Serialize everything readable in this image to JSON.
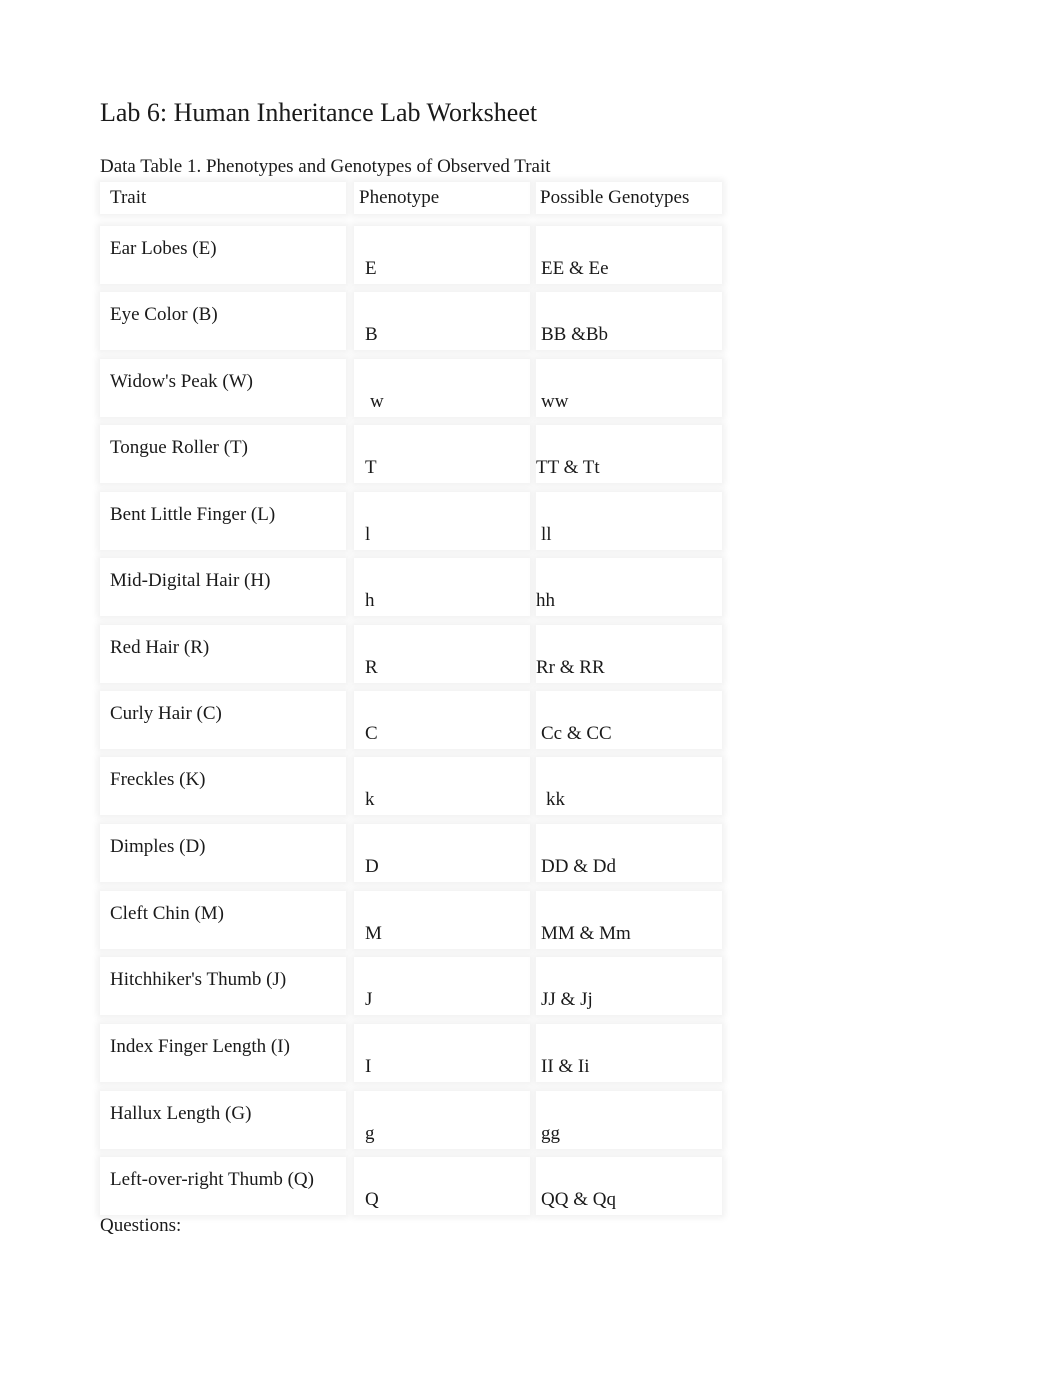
{
  "document": {
    "title": "Lab 6: Human Inheritance Lab Worksheet",
    "table_caption": "Data Table 1. Phenotypes and Genotypes of Observed Trait",
    "table": {
      "headers": [
        "Trait",
        "Phenotype",
        "Possible Genotypes"
      ],
      "rows": [
        {
          "trait": "Ear Lobes (E)",
          "phenotype": "E",
          "genotypes": "EE & Ee"
        },
        {
          "trait": "Eye Color (B)",
          "phenotype": "B",
          "genotypes": "BB &Bb"
        },
        {
          "trait": "Widow's Peak (W)",
          "phenotype": "w",
          "genotypes": "ww"
        },
        {
          "trait": "Tongue Roller (T)",
          "phenotype": "T",
          "genotypes": "TT & Tt"
        },
        {
          "trait": "Bent Little Finger (L)",
          "phenotype": "l",
          "genotypes": "ll"
        },
        {
          "trait": "Mid-Digital Hair (H)",
          "phenotype": "h",
          "genotypes": "hh"
        },
        {
          "trait": "Red Hair (R)",
          "phenotype": "R",
          "genotypes": "Rr & RR"
        },
        {
          "trait": "Curly Hair (C)",
          "phenotype": "C",
          "genotypes": "Cc & CC"
        },
        {
          "trait": "Freckles (K)",
          "phenotype": "k",
          "genotypes": "kk"
        },
        {
          "trait": "Dimples (D)",
          "phenotype": "D",
          "genotypes": "DD & Dd"
        },
        {
          "trait": "Cleft Chin (M)",
          "phenotype": "M",
          "genotypes": "MM & Mm"
        },
        {
          "trait": "Hitchhiker's Thumb (J)",
          "phenotype": "J",
          "genotypes": "JJ & Jj"
        },
        {
          "trait": "Index Finger Length (I)",
          "phenotype": "I",
          "genotypes": "II & Ii"
        },
        {
          "trait": "Hallux Length (G)",
          "phenotype": "g",
          "genotypes": "gg"
        },
        {
          "trait": "Left-over-right Thumb (Q)",
          "phenotype": "Q",
          "genotypes": "QQ & Qq"
        }
      ]
    },
    "questions_label": "Questions:"
  }
}
